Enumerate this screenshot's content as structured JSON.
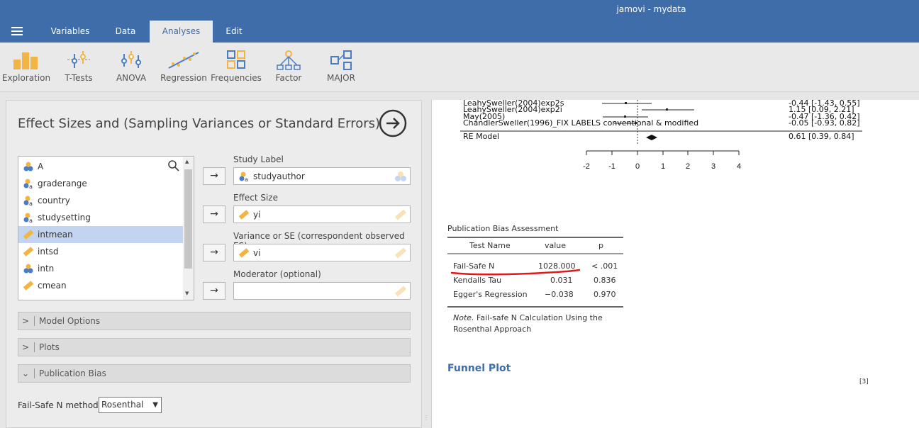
{
  "window": {
    "title": "jamovi - mydata"
  },
  "menu": {
    "tabs": [
      {
        "label": "Variables"
      },
      {
        "label": "Data"
      },
      {
        "label": "Analyses"
      },
      {
        "label": "Edit"
      }
    ]
  },
  "ribbon": {
    "items": [
      {
        "label": "Exploration",
        "icon": "exploration-icon"
      },
      {
        "label": "T-Tests",
        "icon": "t-tests-icon"
      },
      {
        "label": "ANOVA",
        "icon": "anova-icon"
      },
      {
        "label": "Regression",
        "icon": "regression-icon"
      },
      {
        "label": "Frequencies",
        "icon": "frequencies-icon"
      },
      {
        "label": "Factor",
        "icon": "factor-icon"
      },
      {
        "label": "MAJOR",
        "icon": "major-icon"
      }
    ]
  },
  "analysis": {
    "title": "Effect Sizes and (Sampling Variances or Standard Errors)",
    "variables": [
      {
        "name": "A",
        "type": "nominal"
      },
      {
        "name": "graderange",
        "type": "nominal-text"
      },
      {
        "name": "country",
        "type": "nominal-text"
      },
      {
        "name": "studysetting",
        "type": "nominal-text"
      },
      {
        "name": "intmean",
        "type": "continuous",
        "selected": true
      },
      {
        "name": "intsd",
        "type": "continuous"
      },
      {
        "name": "intn",
        "type": "nominal"
      },
      {
        "name": "cmean",
        "type": "continuous"
      }
    ],
    "targets": {
      "study_label": {
        "label": "Study Label",
        "value": "studyauthor"
      },
      "effect_size": {
        "label": "Effect Size",
        "value": "yi"
      },
      "variance": {
        "label": "Variance or SE (correspondent observed ES)",
        "value": "vi"
      },
      "moderator": {
        "label": "Moderator (optional)",
        "value": ""
      }
    },
    "transfer_arrow": "→",
    "sections": [
      {
        "label": "Model Options",
        "expanded": false
      },
      {
        "label": "Plots",
        "expanded": false
      },
      {
        "label": "Publication Bias",
        "expanded": true
      }
    ],
    "failsafe": {
      "label": "Fail-Safe N method",
      "value": "Rosenthal"
    }
  },
  "results": {
    "forest": {
      "studies": [
        {
          "name": "LeahySweller(2004)exp2s",
          "estimate": "-0.44 [-1.43, 0.55]"
        },
        {
          "name": "LeahySweller(2004)exp2i",
          "estimate": "1.15 [0.09, 2.21]"
        },
        {
          "name": "May(2005)",
          "estimate": "-0.47 [-1.36, 0.42]"
        },
        {
          "name": "ChandlerSweller(1996)_FIX LABELS conventional & modified",
          "estimate": "-0.05 [-0.93, 0.82]"
        }
      ],
      "model": {
        "name": "RE Model",
        "estimate": "0.61 [0.39, 0.84]"
      },
      "axis_ticks": [
        "-2",
        "-1",
        "0",
        "1",
        "2",
        "3",
        "4"
      ]
    },
    "pba": {
      "title": "Publication Bias Assessment",
      "headers": [
        "Test Name",
        "value",
        "p"
      ],
      "rows": [
        {
          "name": "Fail-Safe N",
          "value": "1028.000",
          "p": "< .001"
        },
        {
          "name": "Kendalls Tau",
          "value": "0.031",
          "p": "0.836"
        },
        {
          "name": "Egger's Regression",
          "value": "−0.038",
          "p": "0.970"
        }
      ],
      "note_prefix": "Note.",
      "note": "Fail-safe N Calculation Using the Rosenthal Approach"
    },
    "funnel_title": "Funnel Plot",
    "ref": "[3]"
  },
  "colors": {
    "brand": "#3e6da9",
    "highlight": "#c2d4ef",
    "annotation": "#e0191b"
  }
}
